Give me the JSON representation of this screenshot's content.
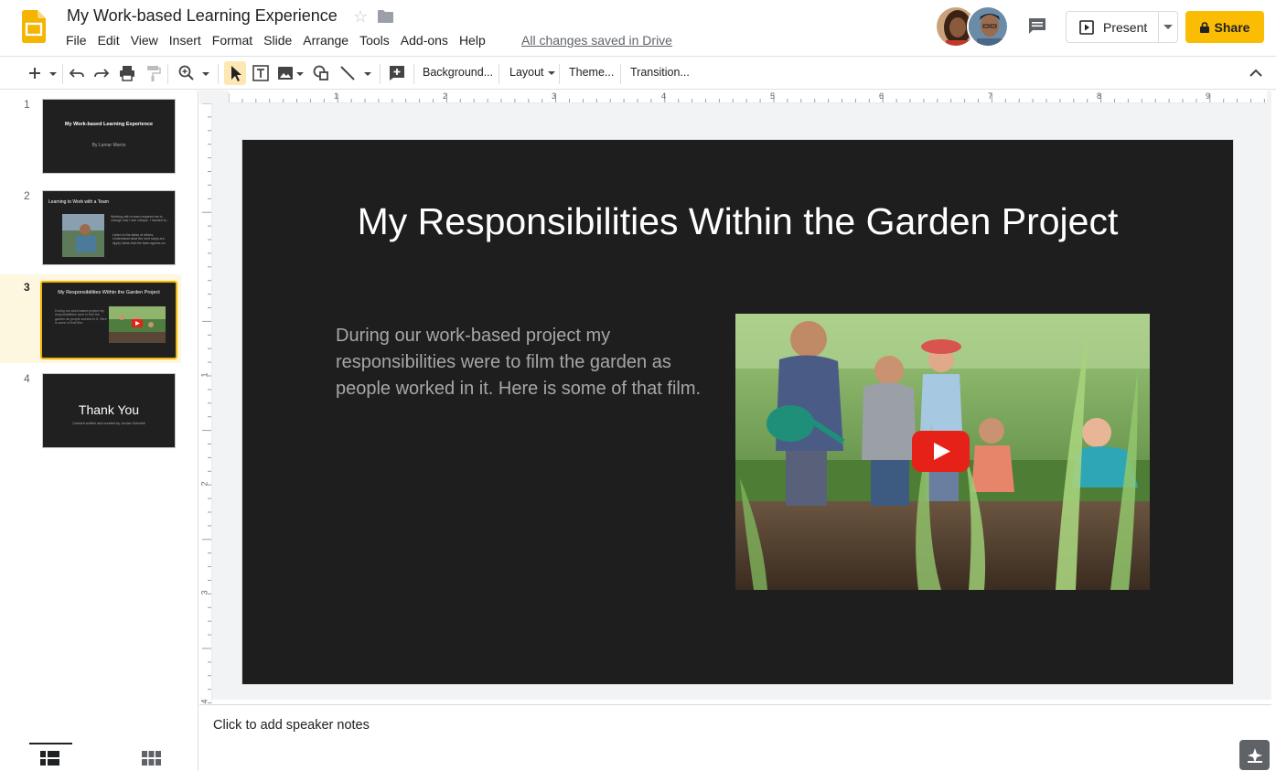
{
  "doc": {
    "title": "My Work-based Learning Experience",
    "saved_status": "All changes saved in Drive"
  },
  "menu": [
    "File",
    "Edit",
    "View",
    "Insert",
    "Format",
    "Slide",
    "Arrange",
    "Tools",
    "Add-ons",
    "Help"
  ],
  "header": {
    "present_label": "Present",
    "share_label": "Share"
  },
  "toolbar": {
    "background_label": "Background...",
    "layout_label": "Layout",
    "theme_label": "Theme...",
    "transition_label": "Transition..."
  },
  "hruler": [
    "1",
    "2",
    "3",
    "4",
    "5",
    "6",
    "7",
    "8",
    "9"
  ],
  "vruler": [
    "1",
    "2",
    "3",
    "4"
  ],
  "slides": [
    {
      "number": "1",
      "title": "My Work-based Learning Experience",
      "subtitle": "By Lamar Morris"
    },
    {
      "number": "2",
      "title": "Learning to Work with a Team",
      "body": "Working with a team required me to change how I see critique. I needed to...",
      "bullets": [
        "Listen to the ideas of others.",
        "Understand what the next steps are.",
        "Apply ideas that the team agrees on."
      ]
    },
    {
      "number": "3",
      "title": "My Responsibilities Within the Garden Project",
      "body": "During our work-based project my responsibilities were to film the garden as people worked in it. Here is some of that film."
    },
    {
      "number": "4",
      "title": "Thank You",
      "subtitle": "Content written and created by Jordan Schmidt"
    }
  ],
  "current_slide": {
    "title": "My Responsibilities Within the Garden Project",
    "body": "During our work-based project my responsibilities were to film the garden as people worked in it. Here is some of that film."
  },
  "notes": {
    "placeholder": "Click to add speaker notes"
  },
  "colors": {
    "accent": "#fbbc04",
    "selection": "#f4b400",
    "slide_bg": "#1e1e1e"
  },
  "icons": [
    "slides-logo-icon",
    "star-icon",
    "folder-icon",
    "comment-icon",
    "present-icon",
    "lock-icon",
    "play-icon",
    "explore-icon"
  ]
}
